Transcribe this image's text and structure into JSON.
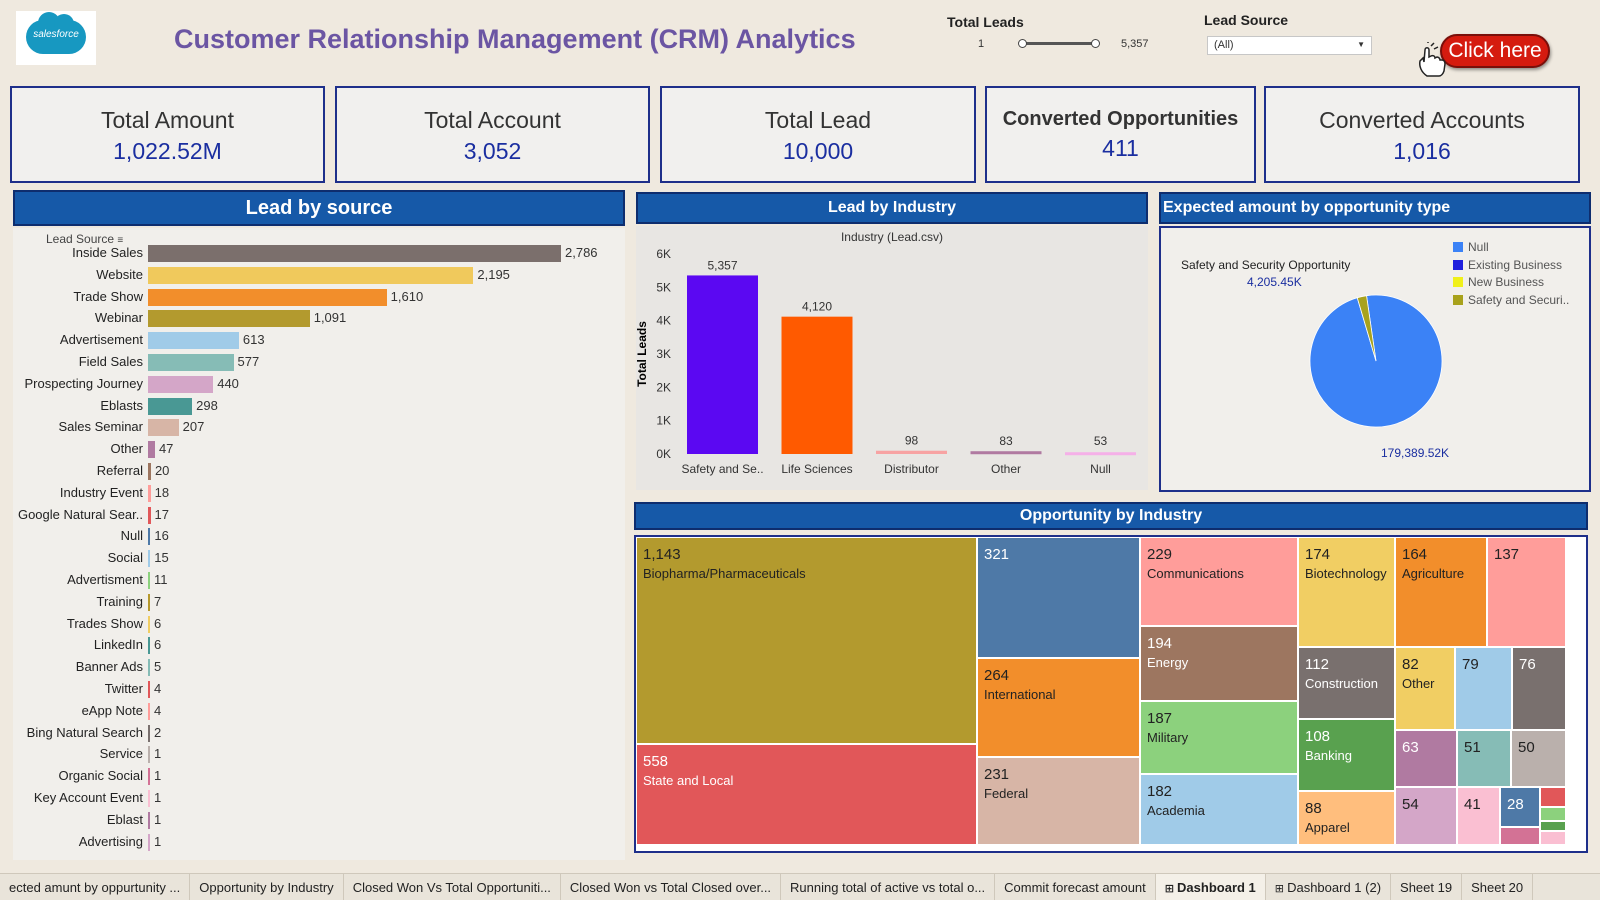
{
  "header": {
    "logo_text": "salesforce",
    "title": "Customer Relationship Management (CRM) Analytics",
    "total_leads_label": "Total Leads",
    "total_leads_min": "1",
    "total_leads_max": "5,357",
    "lead_source_label": "Lead Source",
    "lead_source_value": "(All)",
    "click_here": "Click here"
  },
  "kpis": [
    {
      "label": "Total Amount",
      "value": "1,022.52M"
    },
    {
      "label": "Total Account",
      "value": "3,052"
    },
    {
      "label": "Total Lead",
      "value": "10,000"
    },
    {
      "label": "Converted Opportunities",
      "value": "411"
    },
    {
      "label": "Converted Accounts",
      "value": "1,016"
    }
  ],
  "lead_by_source": {
    "title": "Lead by source",
    "column_header": "Lead Source",
    "rows": [
      {
        "label": "Inside Sales",
        "value": 2786,
        "text": "2,786",
        "color": "#7b6f6c"
      },
      {
        "label": "Website",
        "value": 2195,
        "text": "2,195",
        "color": "#f0c95c"
      },
      {
        "label": "Trade Show",
        "value": 1610,
        "text": "1,610",
        "color": "#f28e2b"
      },
      {
        "label": "Webinar",
        "value": 1091,
        "text": "1,091",
        "color": "#b39a2e"
      },
      {
        "label": "Advertisement",
        "value": 613,
        "text": "613",
        "color": "#a0cbe8"
      },
      {
        "label": "Field Sales",
        "value": 577,
        "text": "577",
        "color": "#86bcb6"
      },
      {
        "label": "Prospecting Journey",
        "value": 440,
        "text": "440",
        "color": "#d4a6c8"
      },
      {
        "label": "Eblasts",
        "value": 298,
        "text": "298",
        "color": "#499894"
      },
      {
        "label": "Sales Seminar",
        "value": 207,
        "text": "207",
        "color": "#d7b5a6"
      },
      {
        "label": "Other",
        "value": 47,
        "text": "47",
        "color": "#b07aa1"
      },
      {
        "label": "Referral",
        "value": 20,
        "text": "20",
        "color": "#9d7660"
      },
      {
        "label": "Industry Event",
        "value": 18,
        "text": "18",
        "color": "#ff9d9a"
      },
      {
        "label": "Google Natural Sear..",
        "value": 17,
        "text": "17",
        "color": "#e15759"
      },
      {
        "label": "Null",
        "value": 16,
        "text": "16",
        "color": "#4e79a7"
      },
      {
        "label": "Social",
        "value": 15,
        "text": "15",
        "color": "#a0cbe8"
      },
      {
        "label": "Advertisment",
        "value": 11,
        "text": "11",
        "color": "#8cd17d"
      },
      {
        "label": "Training",
        "value": 7,
        "text": "7",
        "color": "#b6992d"
      },
      {
        "label": "Trades Show",
        "value": 6,
        "text": "6",
        "color": "#f1ce63"
      },
      {
        "label": "LinkedIn",
        "value": 6,
        "text": "6",
        "color": "#499894"
      },
      {
        "label": "Banner Ads",
        "value": 5,
        "text": "5",
        "color": "#86bcb6"
      },
      {
        "label": "Twitter",
        "value": 4,
        "text": "4",
        "color": "#e15759"
      },
      {
        "label": "eApp Note",
        "value": 4,
        "text": "4",
        "color": "#ff9d9a"
      },
      {
        "label": "Bing Natural Search",
        "value": 2,
        "text": "2",
        "color": "#79706e"
      },
      {
        "label": "Service",
        "value": 1,
        "text": "1",
        "color": "#bab0ac"
      },
      {
        "label": "Organic Social",
        "value": 1,
        "text": "1",
        "color": "#d37295"
      },
      {
        "label": "Key Account Event",
        "value": 1,
        "text": "1",
        "color": "#fabfd2"
      },
      {
        "label": "Eblast",
        "value": 1,
        "text": "1",
        "color": "#b07aa1"
      },
      {
        "label": "Advertising",
        "value": 1,
        "text": "1",
        "color": "#d4a6c8"
      }
    ]
  },
  "lead_by_industry": {
    "title": "Lead by Industry",
    "subtitle": "Industry (Lead.csv)",
    "ylabel": "Total Leads",
    "ticks": [
      "0K",
      "1K",
      "2K",
      "3K",
      "4K",
      "5K",
      "6K"
    ]
  },
  "expected_amount": {
    "title": "Expected amount by opportunity type",
    "callout_label": "Safety and Security Opportunity",
    "callout_value": "4,205.45K",
    "main_value": "179,389.52K",
    "legend": [
      {
        "label": "Null",
        "color": "#3b82f6"
      },
      {
        "label": "Existing Business",
        "color": "#1f1fdd"
      },
      {
        "label": "New Business",
        "color": "#f0f01a"
      },
      {
        "label": "Safety and Securi..",
        "color": "#a8a21c"
      }
    ]
  },
  "opportunity_by_industry": {
    "title": "Opportunity by Industry",
    "cells": [
      {
        "value": "1,143",
        "label": "Biopharma/Pharmaceuticals",
        "color": "#b39a2e",
        "dark": true
      },
      {
        "value": "558",
        "label": "State and Local",
        "color": "#e15759",
        "dark": false
      },
      {
        "value": "321",
        "label": "",
        "color": "#4e79a7",
        "dark": false
      },
      {
        "value": "264",
        "label": "International",
        "color": "#f28e2b",
        "dark": true
      },
      {
        "value": "231",
        "label": "Federal",
        "color": "#d7b5a6",
        "dark": true
      },
      {
        "value": "229",
        "label": "Communications",
        "color": "#ff9d9a",
        "dark": true
      },
      {
        "value": "194",
        "label": "Energy",
        "color": "#9d7660",
        "dark": false
      },
      {
        "value": "187",
        "label": "Military",
        "color": "#8cd17d",
        "dark": true
      },
      {
        "value": "182",
        "label": "Academia",
        "color": "#a0cbe8",
        "dark": true
      },
      {
        "value": "174",
        "label": "Biotechnology",
        "color": "#f1ce63",
        "dark": true
      },
      {
        "value": "164",
        "label": "Agriculture",
        "color": "#f28e2b",
        "dark": true
      },
      {
        "value": "137",
        "label": "",
        "color": "#ff9d9a",
        "dark": true
      },
      {
        "value": "112",
        "label": "Construction",
        "color": "#79706e",
        "dark": false
      },
      {
        "value": "82",
        "label": "Other",
        "color": "#f1ce63",
        "dark": true
      },
      {
        "value": "79",
        "label": "",
        "color": "#a0cbe8",
        "dark": true
      },
      {
        "value": "76",
        "label": "",
        "color": "#79706e",
        "dark": false
      },
      {
        "value": "108",
        "label": "Banking",
        "color": "#59a14f",
        "dark": false
      },
      {
        "value": "63",
        "label": "",
        "color": "#b07aa1",
        "dark": false
      },
      {
        "value": "51",
        "label": "",
        "color": "#86bcb6",
        "dark": true
      },
      {
        "value": "50",
        "label": "",
        "color": "#bab0ac",
        "dark": true
      },
      {
        "value": "88",
        "label": "Apparel",
        "color": "#ffbe7d",
        "dark": true
      },
      {
        "value": "54",
        "label": "",
        "color": "#d4a6c8",
        "dark": true
      },
      {
        "value": "41",
        "label": "",
        "color": "#fabfd2",
        "dark": true
      },
      {
        "value": "28",
        "label": "",
        "color": "#4e79a7",
        "dark": false
      }
    ]
  },
  "tabs": [
    "ected amunt by oppurtunity ...",
    "Opportunity by Industry",
    "Closed Won Vs Total Opportuniti...",
    "Closed Won vs Total Closed over...",
    "Running total of active vs total o...",
    "Commit forecast amount",
    "Dashboard 1",
    "Dashboard 1 (2)",
    "Sheet 19",
    "Sheet 20"
  ],
  "chart_data": [
    {
      "type": "bar",
      "title": "Lead by source",
      "categories": [
        "Inside Sales",
        "Website",
        "Trade Show",
        "Webinar",
        "Advertisement",
        "Field Sales",
        "Prospecting Journey",
        "Eblasts",
        "Sales Seminar",
        "Other",
        "Referral",
        "Industry Event",
        "Google Natural Sear..",
        "Null",
        "Social",
        "Advertisment",
        "Training",
        "Trades Show",
        "LinkedIn",
        "Banner Ads",
        "Twitter",
        "eApp Note",
        "Bing Natural Search",
        "Service",
        "Organic Social",
        "Key Account Event",
        "Eblast",
        "Advertising"
      ],
      "values": [
        2786,
        2195,
        1610,
        1091,
        613,
        577,
        440,
        298,
        207,
        47,
        20,
        18,
        17,
        16,
        15,
        11,
        7,
        6,
        6,
        5,
        4,
        4,
        2,
        1,
        1,
        1,
        1,
        1
      ]
    },
    {
      "type": "bar",
      "title": "Lead by Industry",
      "xlabel": "Industry (Lead.csv)",
      "ylabel": "Total Leads",
      "categories": [
        "Safety and Se..",
        "Life Sciences",
        "Distributor",
        "Other",
        "Null"
      ],
      "values": [
        5357,
        4120,
        98,
        83,
        53
      ],
      "value_labels": [
        "5,357",
        "4,120",
        "98",
        "83",
        "53"
      ],
      "colors": [
        "#5b08f2",
        "#ff5a00",
        "#f7a3a3",
        "#b07aa1",
        "#f5b0e8"
      ],
      "ylim": [
        0,
        6000
      ]
    },
    {
      "type": "pie",
      "title": "Expected amount by opportunity type",
      "labels": [
        "Null",
        "Safety and Securi.."
      ],
      "values": [
        179389.52,
        4205.45
      ]
    }
  ]
}
